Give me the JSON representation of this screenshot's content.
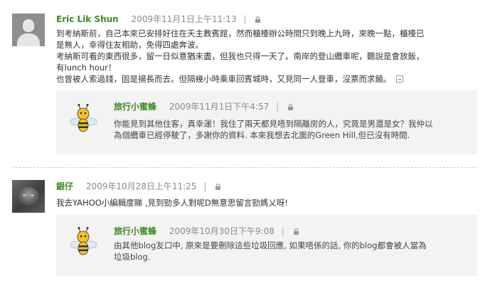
{
  "comments": [
    {
      "author": "Eric Lik Shun",
      "date": "2009年11月1日上午11:13",
      "separator": "|",
      "avatar_icon": "default-user-avatar-icon",
      "text_lines": [
        "到考納斯前，自己本來已安排好住在天主教賓館，然而櫃檯辦公時間只到晚上九時，來晚一點，櫃檯已",
        "是無人，幸得住友相助，免得四處奔波。",
        "考納斯可看的東西很多，留一日似意猶未盡，但我也只得一天了。南岸的登山纜車呢，聽說是會放飯，",
        "有lunch hour！",
        "也曾被人索過錢，固是揚長而去。但隔幾小時乘車回賓城時，又見同一人登車，沒票而求饒。"
      ],
      "reply": {
        "author": "旅行小蜜蜂",
        "date": "2009年11月1日下午4:57",
        "separator": "|",
        "avatar_icon": "bee-mascot-icon",
        "text_lines": [
          "你能見到其他住客，真幸運！我住了兩天都見唔到隔離房的人，究竟是男還是女？我仲以",
          "為個纜車已經停駛了，多謝你的資料. 本來我想去北面的Green Hill,但已沒有時間."
        ]
      }
    },
    {
      "author": "銀仔",
      "date": "2009年10月28日上午11:25",
      "separator": "|",
      "avatar_icon": "cat-photo-avatar-icon",
      "text_lines": [
        "我去YAHOO小編輯度睇 ,見到勁多人對呢D無意思留言勁媽乂呀!"
      ],
      "reply": {
        "author": "旅行小蜜蜂",
        "date": "2009年10月30日下午9:08",
        "separator": "|",
        "avatar_icon": "bee-mascot-icon",
        "text_lines": [
          "由其他blog友口中, 原來是要刪除這些垃圾回應, 如果唔係的話, 你的blog都會被人當為",
          "垃圾blog."
        ]
      }
    }
  ],
  "icons": {
    "lock": "lock-icon",
    "collapse": "collapse-icon"
  },
  "colors": {
    "author": "#3c8a1e",
    "date": "#8a8a8a",
    "reply_bg": "#f3f3f3"
  }
}
